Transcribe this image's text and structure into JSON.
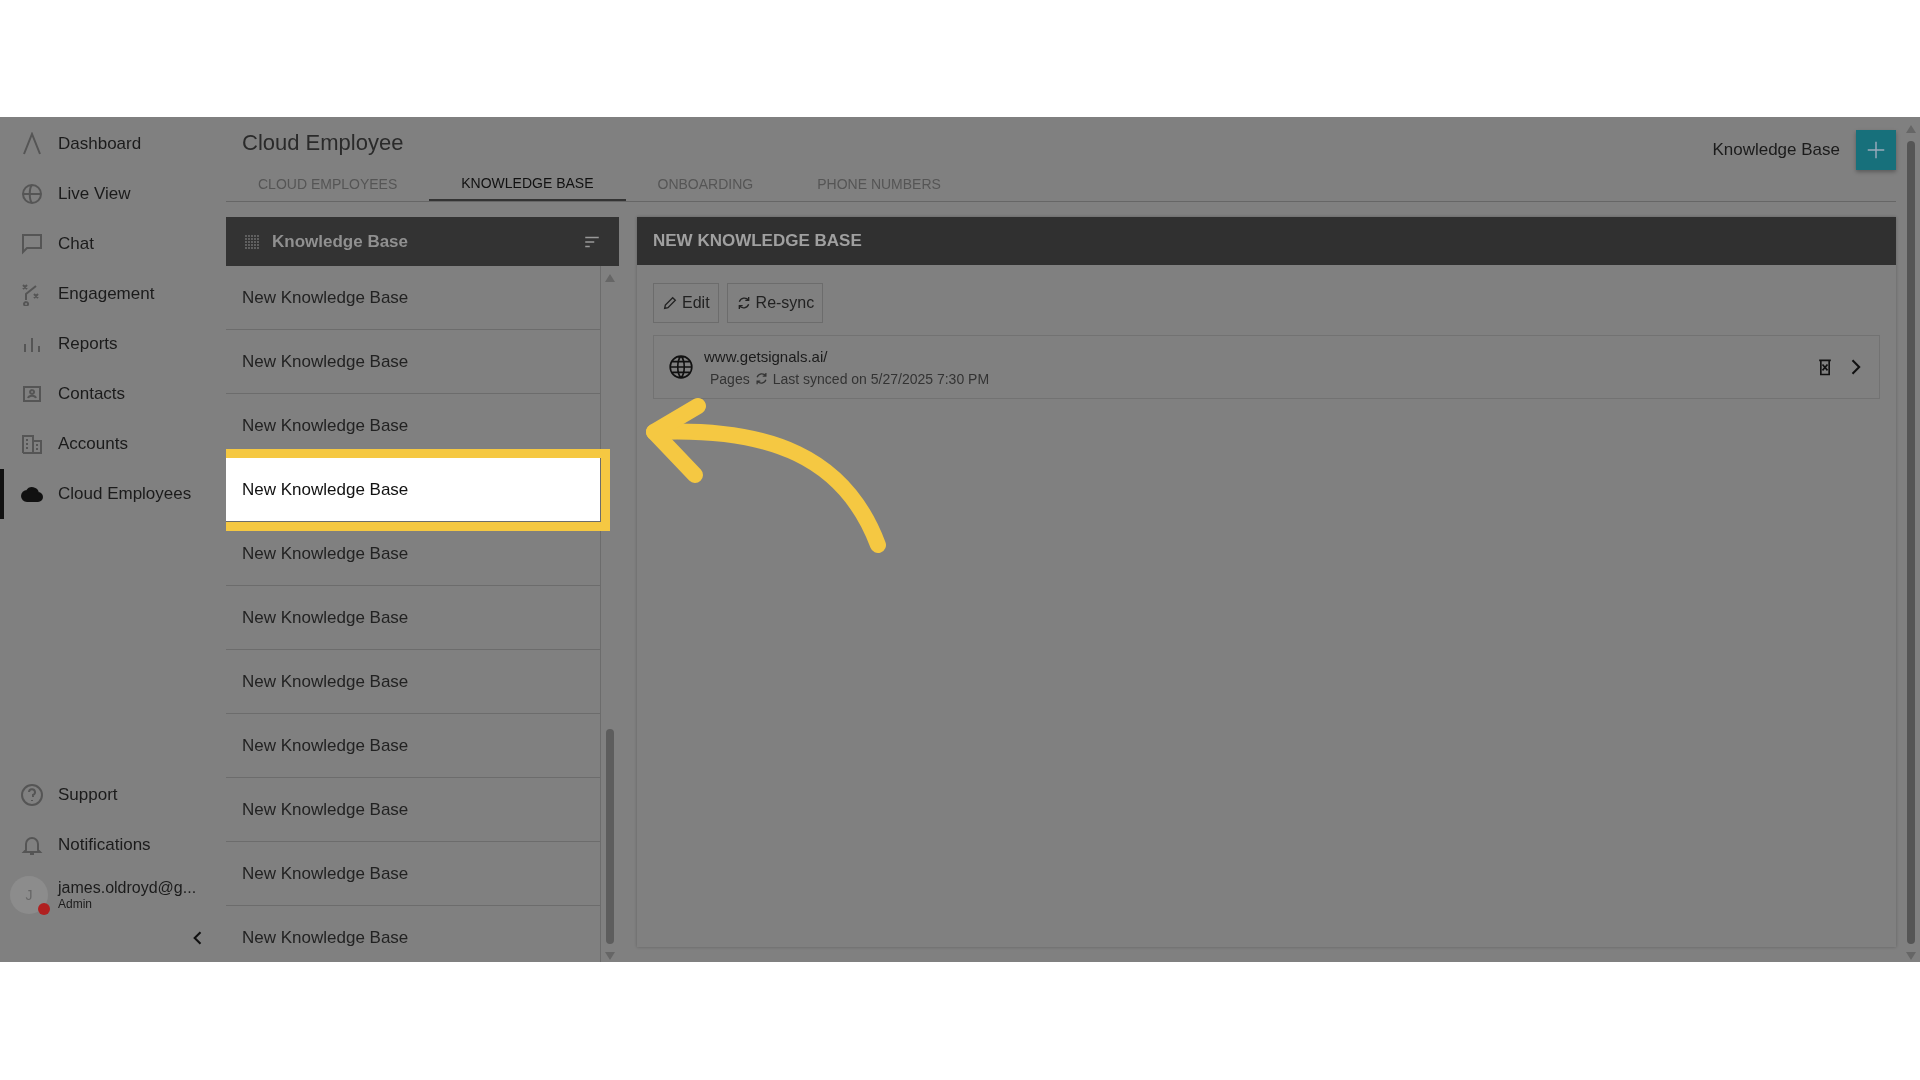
{
  "sidebar": {
    "items": [
      {
        "label": "Dashboard",
        "selected": false
      },
      {
        "label": "Live View",
        "selected": false
      },
      {
        "label": "Chat",
        "selected": false
      },
      {
        "label": "Engagement",
        "selected": false
      },
      {
        "label": "Reports",
        "selected": false
      },
      {
        "label": "Contacts",
        "selected": false
      },
      {
        "label": "Accounts",
        "selected": false
      },
      {
        "label": "Cloud Employees",
        "selected": true
      }
    ],
    "bottom_items": [
      {
        "label": "Support"
      },
      {
        "label": "Notifications"
      }
    ],
    "user": {
      "initial": "J",
      "name": "james.oldroyd@g...",
      "role": "Admin"
    }
  },
  "page": {
    "title": "Cloud Employee",
    "action_label": "Knowledge Base"
  },
  "tabs": [
    {
      "label": "CLOUD EMPLOYEES",
      "selected": false
    },
    {
      "label": "KNOWLEDGE BASE",
      "selected": true
    },
    {
      "label": "ONBOARDING",
      "selected": false
    },
    {
      "label": "PHONE NUMBERS",
      "selected": false
    }
  ],
  "list": {
    "title": "Knowledge Base",
    "items": [
      {
        "label": "New Knowledge Base",
        "selected": false
      },
      {
        "label": "New Knowledge Base",
        "selected": false
      },
      {
        "label": "New Knowledge Base",
        "selected": false
      },
      {
        "label": "New Knowledge Base",
        "selected": true
      },
      {
        "label": "New Knowledge Base",
        "selected": false
      },
      {
        "label": "New Knowledge Base",
        "selected": false
      },
      {
        "label": "New Knowledge Base",
        "selected": false
      },
      {
        "label": "New Knowledge Base",
        "selected": false
      },
      {
        "label": "New Knowledge Base",
        "selected": false
      },
      {
        "label": "New Knowledge Base",
        "selected": false
      },
      {
        "label": "New Knowledge Base",
        "selected": false
      }
    ]
  },
  "detail": {
    "title": "NEW KNOWLEDGE BASE",
    "buttons": [
      {
        "label": "Edit"
      },
      {
        "label": "Re-sync"
      }
    ],
    "sources": [
      {
        "url": "www.getsignals.ai/",
        "pages": "Pages",
        "synced": "Last synced on 5/27/2025 7:30 PM"
      }
    ]
  }
}
